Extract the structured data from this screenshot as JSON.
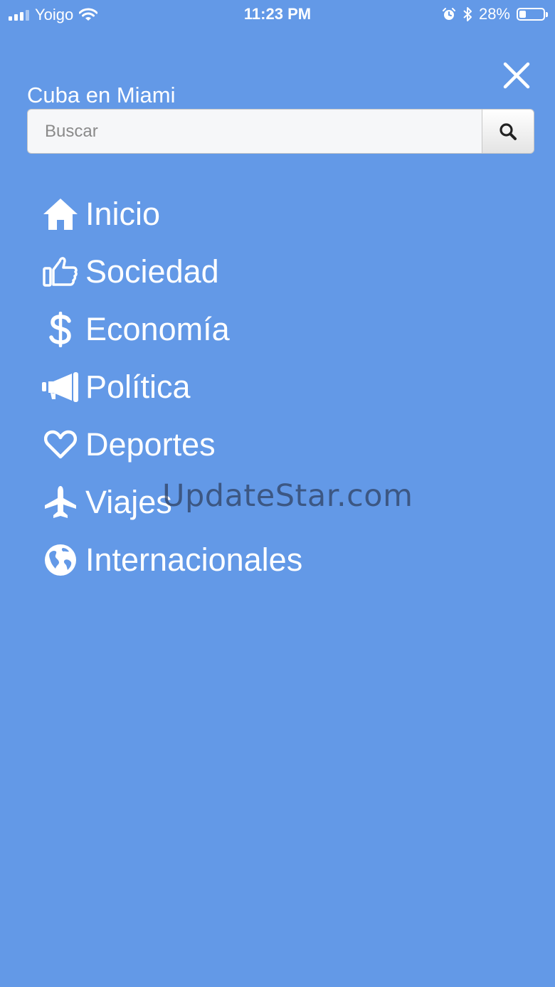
{
  "status_bar": {
    "carrier": "Yoigo",
    "time": "11:23 PM",
    "battery_text": "28%",
    "battery_level": 0.28,
    "icons": [
      "signal-icon",
      "wifi-icon",
      "alarm-icon",
      "bluetooth-icon",
      "battery-icon"
    ]
  },
  "header": {
    "site_title": "Cuba en Miami",
    "close_icon": "close-icon"
  },
  "search": {
    "placeholder": "Buscar",
    "value": "",
    "button_icon": "search-icon"
  },
  "menu": {
    "items": [
      {
        "label": "Inicio",
        "icon": "home-icon"
      },
      {
        "label": "Sociedad",
        "icon": "thumbs-up-icon"
      },
      {
        "label": "Economía",
        "icon": "dollar-icon"
      },
      {
        "label": "Política",
        "icon": "megaphone-icon"
      },
      {
        "label": "Deportes",
        "icon": "heart-icon"
      },
      {
        "label": "Viajes",
        "icon": "plane-icon"
      },
      {
        "label": "Internacionales",
        "icon": "globe-icon"
      }
    ]
  },
  "watermark": "UpdateStar.com",
  "colors": {
    "background": "#6399e7",
    "text": "#ffffff",
    "search_field": "#f6f7f9"
  }
}
